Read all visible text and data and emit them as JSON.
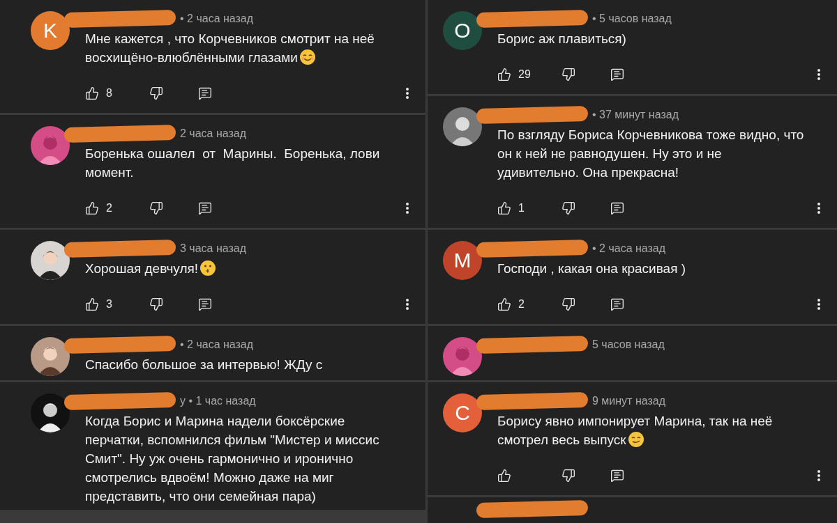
{
  "columns": [
    {
      "comments": [
        {
          "kind": "full",
          "name_redacted": true,
          "avatar": {
            "kind": "letter",
            "letter": "K",
            "color": "#e27a30"
          },
          "time": "• 2 часа назад",
          "text": "Мне кажется , что Корчевников смотрит на неё восхищёно-влюблёнными глазами",
          "emoji": {
            "kind": "smile"
          },
          "likes": "8"
        },
        {
          "kind": "full",
          "name_redacted": true,
          "time": "2 часа назад",
          "text": "Боренька ошалел  от  Марины.  Боренька, лови момент.",
          "likes": "2"
        },
        {
          "kind": "full",
          "name_redacted": true,
          "time": "3 часа назад",
          "text": "Хорошая девчуля!",
          "emoji": {
            "kind": "kiss"
          },
          "likes": "3"
        },
        {
          "kind": "cut",
          "name_redacted": true,
          "time": "• 2 часа назад",
          "text": "Спасибо большое за интервью! ЖДу с"
        },
        {
          "kind": "cut",
          "name_redacted": true,
          "time": "у • 1 час назад",
          "text": "Когда Борис и Марина надели боксёрские перчатки, вспомнился фильм \"Мистер и миссис Смит\". Ну уж очень гармонично и иронично смотрелись вдвоём! Можно даже на миг представить, что они семейная пара)"
        }
      ]
    },
    {
      "comments": [
        {
          "kind": "full",
          "name_redacted": true,
          "avatar": {
            "kind": "letter",
            "letter": "O",
            "color": "#1f4d40"
          },
          "time": "• 5 часов назад",
          "text": "Борис аж плавиться)",
          "likes": "29"
        },
        {
          "kind": "full",
          "name_redacted": true,
          "time": "• 37 минут назад",
          "text": "По взгляду Бориса Корчевникова тоже видно, что он к ней не равнодушен. Ну это и не удивительно. Она прекрасна!",
          "likes": "1"
        },
        {
          "kind": "full",
          "name_redacted": true,
          "avatar": {
            "kind": "letter",
            "letter": "M",
            "color": "#c0442a"
          },
          "time": "• 2 часа назад",
          "text": "Господи , какая она красивая )",
          "likes": "2"
        },
        {
          "kind": "cut",
          "name_redacted": true,
          "time": "5 часов назад"
        },
        {
          "kind": "full",
          "name_redacted": true,
          "avatar": {
            "kind": "letter",
            "letter": "C",
            "color": "#e3603a"
          },
          "time": "9 минут назад",
          "text": "Борису явно импонирует Марина, так на неё смотрел весь выпуск",
          "emoji": {
            "kind": "drool"
          }
        },
        {
          "kind": "stub",
          "name_redacted": true
        }
      ]
    }
  ]
}
